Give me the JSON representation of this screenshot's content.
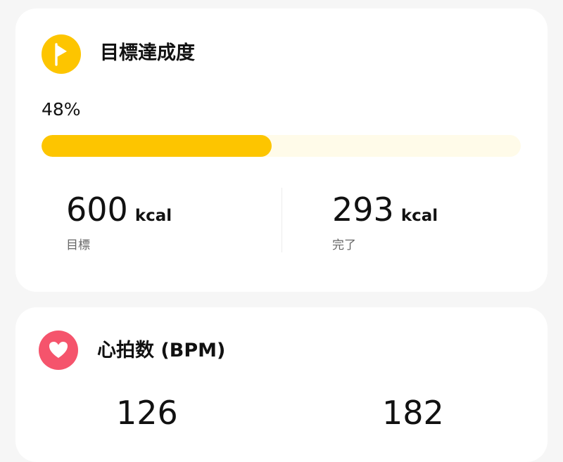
{
  "colors": {
    "accent_yellow": "#fdc500",
    "track_light": "#fffbe9",
    "heart_red": "#f5546c",
    "text": "#111111",
    "muted": "#666666"
  },
  "goal_card": {
    "title": "目標達成度",
    "icon": "flag-icon",
    "percent_label": "48%",
    "progress": 0.48,
    "goal": {
      "value": "600",
      "unit": "kcal",
      "label": "目標"
    },
    "done": {
      "value": "293",
      "unit": "kcal",
      "label": "完了"
    }
  },
  "heart_card": {
    "title": "心拍数 (BPM)",
    "icon": "heart-icon",
    "values": [
      "126",
      "182"
    ]
  }
}
